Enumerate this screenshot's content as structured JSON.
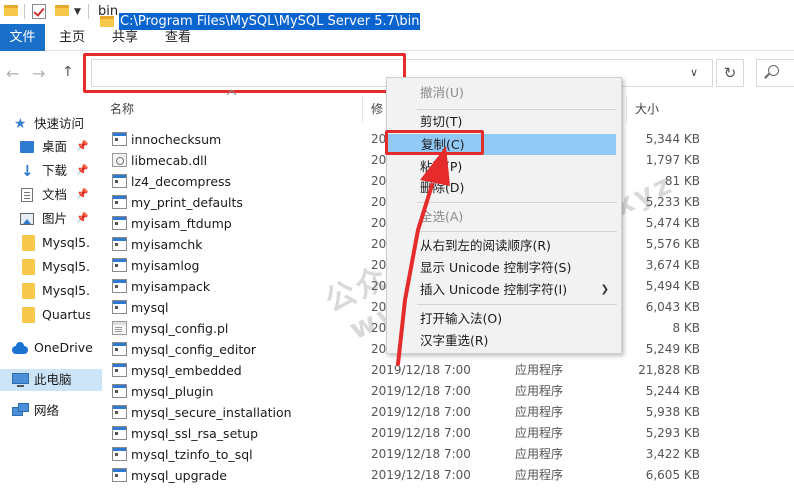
{
  "window": {
    "title": "bin"
  },
  "ribbon": {
    "tabs": [
      "文件",
      "主页",
      "共享",
      "查看"
    ]
  },
  "address": {
    "path": "C:\\Program Files\\MySQL\\MySQL Server 5.7\\bin"
  },
  "columns": {
    "name": "名称",
    "modified": "修",
    "size": "大小"
  },
  "sidebar": {
    "items": [
      {
        "label": "快速访问",
        "icon": "star-icon"
      },
      {
        "label": "桌面",
        "icon": "desktop-icon",
        "pinned": true
      },
      {
        "label": "下载",
        "icon": "download-icon",
        "pinned": true
      },
      {
        "label": "文档",
        "icon": "document-icon",
        "pinned": true
      },
      {
        "label": "图片",
        "icon": "picture-icon",
        "pinned": true
      },
      {
        "label": "Mysql5.5",
        "icon": "folder-icon"
      },
      {
        "label": "Mysql5.6",
        "icon": "folder-icon"
      },
      {
        "label": "Mysql5.7",
        "icon": "folder-icon"
      },
      {
        "label": "Quartus",
        "icon": "folder-icon"
      },
      {
        "label": "OneDrive",
        "icon": "onedrive-icon"
      },
      {
        "label": "此电脑",
        "icon": "this-pc-icon",
        "selected": true
      },
      {
        "label": "网络",
        "icon": "network-icon"
      }
    ]
  },
  "files": [
    {
      "name": "innochecksum",
      "date": "20",
      "type": "",
      "size": "5,344 KB",
      "icon": "exe"
    },
    {
      "name": "libmecab.dll",
      "date": "20",
      "type": "",
      "size": "1,797 KB",
      "icon": "dll"
    },
    {
      "name": "lz4_decompress",
      "date": "20",
      "type": "",
      "size": "81 KB",
      "icon": "exe"
    },
    {
      "name": "my_print_defaults",
      "date": "20",
      "type": "",
      "size": "5,233 KB",
      "icon": "exe"
    },
    {
      "name": "myisam_ftdump",
      "date": "20",
      "type": "",
      "size": "5,474 KB",
      "icon": "exe"
    },
    {
      "name": "myisamchk",
      "date": "20",
      "type": "",
      "size": "5,576 KB",
      "icon": "exe"
    },
    {
      "name": "myisamlog",
      "date": "20",
      "type": "",
      "size": "3,674 KB",
      "icon": "exe"
    },
    {
      "name": "myisampack",
      "date": "20",
      "type": "",
      "size": "5,494 KB",
      "icon": "exe"
    },
    {
      "name": "mysql",
      "date": "20",
      "type": "",
      "size": "6,043 KB",
      "icon": "exe"
    },
    {
      "name": "mysql_config.pl",
      "date": "20",
      "type": "",
      "size": "8 KB",
      "icon": "cfg"
    },
    {
      "name": "mysql_config_editor",
      "date": "20",
      "type": "",
      "size": "5,249 KB",
      "icon": "exe"
    },
    {
      "name": "mysql_embedded",
      "date": "2019/12/18 7:00",
      "type": "应用程序",
      "size": "21,828 KB",
      "icon": "exe"
    },
    {
      "name": "mysql_plugin",
      "date": "2019/12/18 7:00",
      "type": "应用程序",
      "size": "5,244 KB",
      "icon": "exe"
    },
    {
      "name": "mysql_secure_installation",
      "date": "2019/12/18 7:00",
      "type": "应用程序",
      "size": "5,938 KB",
      "icon": "exe"
    },
    {
      "name": "mysql_ssl_rsa_setup",
      "date": "2019/12/18 7:00",
      "type": "应用程序",
      "size": "5,293 KB",
      "icon": "exe"
    },
    {
      "name": "mysql_tzinfo_to_sql",
      "date": "2019/12/18 7:00",
      "type": "应用程序",
      "size": "3,422 KB",
      "icon": "exe"
    },
    {
      "name": "mysql_upgrade",
      "date": "2019/12/18 7:00",
      "type": "应用程序",
      "size": "6,605 KB",
      "icon": "exe"
    }
  ],
  "context_menu": {
    "items": [
      {
        "label": "撤消(U)",
        "disabled": true
      },
      {
        "separator": true
      },
      {
        "label": "剪切(T)"
      },
      {
        "label": "复制(C)",
        "highlighted": true
      },
      {
        "label": "粘贴(P)"
      },
      {
        "label": "删除(D)"
      },
      {
        "separator": true
      },
      {
        "label": "全选(A)",
        "disabled": true
      },
      {
        "separator": true
      },
      {
        "label": "从右到左的阅读顺序(R)"
      },
      {
        "label": "显示 Unicode 控制字符(S)"
      },
      {
        "label": "插入 Unicode 控制字符(I)",
        "submenu": true
      },
      {
        "separator": true
      },
      {
        "label": "打开输入法(O)"
      },
      {
        "label": "汉字重选(R)"
      }
    ]
  },
  "watermark": {
    "line1": "公众号：猫咪软件社",
    "line2": "www.08082022.xyz"
  },
  "colors": {
    "accent": "#1a6fc8",
    "selection": "#0a64d0",
    "highlight": "#91c9f7",
    "annotation": "#e52b2b"
  }
}
